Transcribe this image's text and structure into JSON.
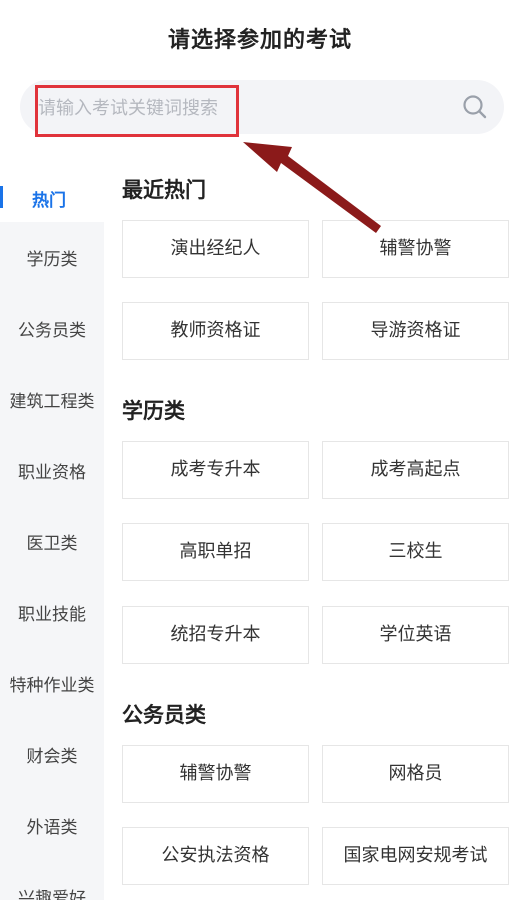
{
  "header": {
    "title": "请选择参加的考试"
  },
  "search": {
    "placeholder": "请输入考试关键词搜索",
    "icon": "search-icon"
  },
  "sidebar": {
    "active": "热门",
    "active_color": "#1a73e8",
    "items": [
      "学历类",
      "公务员类",
      "建筑工程类",
      "职业资格",
      "医卫类",
      "职业技能",
      "特种作业类",
      "财会类",
      "外语类",
      "兴趣爱好"
    ]
  },
  "sections": [
    {
      "title": "最近热门",
      "items": [
        "演出经纪人",
        "辅警协警",
        "教师资格证",
        "导游资格证"
      ]
    },
    {
      "title": "学历类",
      "items": [
        "成考专升本",
        "成考高起点",
        "高职单招",
        "三校生",
        "统招专升本",
        "学位英语"
      ]
    },
    {
      "title": "公务员类",
      "items": [
        "辅警协警",
        "网格员",
        "公安执法资格",
        "国家电网安规考试"
      ]
    }
  ],
  "colors": {
    "accent": "#1a73e8",
    "highlight": "#e0333b",
    "arrow": "#8b1a1a"
  }
}
